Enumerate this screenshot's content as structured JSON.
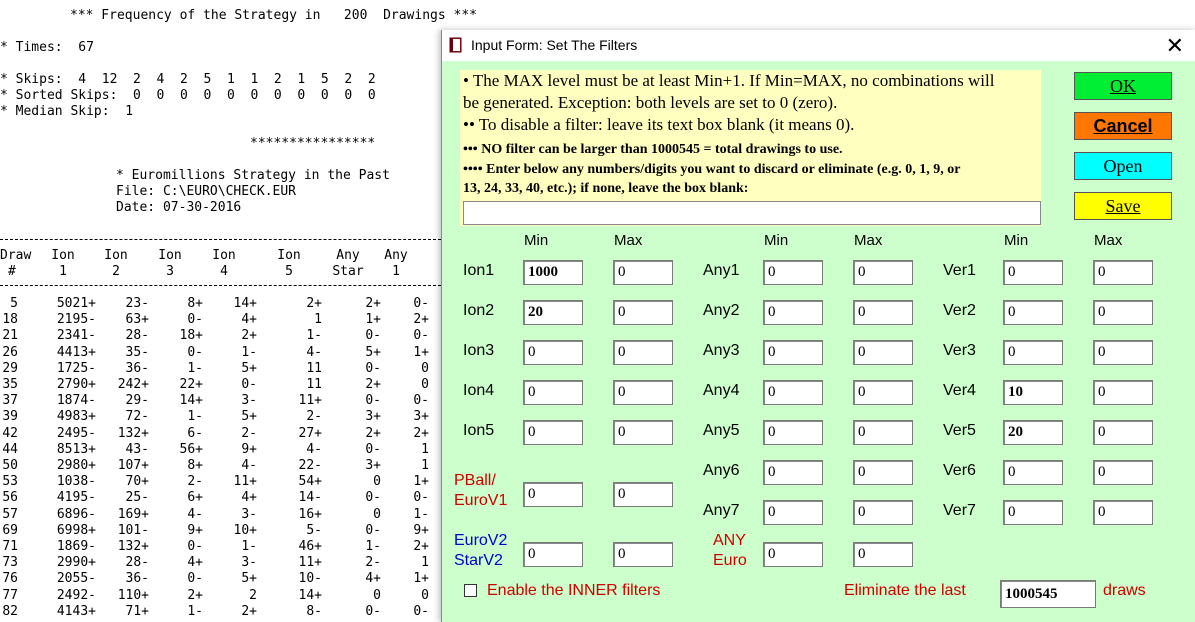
{
  "report": {
    "header": "*** Frequency of the Strategy in   200  Drawings ***",
    "times": "* Times:  67",
    "skips": "* Skips:  4  12  2  4  2  5  1  1  2  1  5  2  2",
    "sorted": "* Sorted Skips:  0  0  0  0  0  0  0  0  0  0  0",
    "median": "* Median Skip:  1",
    "stars": "****************",
    "strategy": "* Euromillions Strategy in the Past",
    "file": "File: C:\\EURO\\CHECK.EUR",
    "date": "Date: 07-30-2016",
    "columns": [
      {
        "h1": "Draw",
        "h2": "#"
      },
      {
        "h1": "Ion",
        "h2": "1"
      },
      {
        "h1": "Ion",
        "h2": "2"
      },
      {
        "h1": "Ion",
        "h2": "3"
      },
      {
        "h1": "Ion",
        "h2": "4"
      },
      {
        "h1": "Ion",
        "h2": "5"
      },
      {
        "h1": "Any",
        "h2": "Star"
      },
      {
        "h1": "Any",
        "h2": "1"
      }
    ],
    "rows": [
      [
        "5",
        "5021+",
        "23-",
        "8+",
        "14+",
        "2+",
        "2+",
        "0-"
      ],
      [
        "18",
        "2195-",
        "63+",
        "0-",
        "4+",
        "1",
        "1+",
        "2+"
      ],
      [
        "21",
        "2341-",
        "28-",
        "18+",
        "2+",
        "1-",
        "0-",
        "0-"
      ],
      [
        "26",
        "4413+",
        "35-",
        "0-",
        "1-",
        "4-",
        "5+",
        "1+"
      ],
      [
        "29",
        "1725-",
        "36-",
        "1-",
        "5+",
        "11",
        "0-",
        "0"
      ],
      [
        "35",
        "2790+",
        "242+",
        "22+",
        "0-",
        "11",
        "2+",
        "0"
      ],
      [
        "37",
        "1874-",
        "29-",
        "14+",
        "3-",
        "11+",
        "0-",
        "0-"
      ],
      [
        "39",
        "4983+",
        "72-",
        "1-",
        "5+",
        "2-",
        "3+",
        "3+"
      ],
      [
        "42",
        "2495-",
        "132+",
        "6-",
        "2-",
        "27+",
        "2+",
        "2+"
      ],
      [
        "44",
        "8513+",
        "43-",
        "56+",
        "9+",
        "4-",
        "0-",
        "1"
      ],
      [
        "50",
        "2980+",
        "107+",
        "8+",
        "4-",
        "22-",
        "3+",
        "1"
      ],
      [
        "53",
        "1038-",
        "70+",
        "2-",
        "11+",
        "54+",
        "0",
        "1+"
      ],
      [
        "56",
        "4195-",
        "25-",
        "6+",
        "4+",
        "14-",
        "0-",
        "0-"
      ],
      [
        "57",
        "6896-",
        "169+",
        "4-",
        "3-",
        "16+",
        "0",
        "1-"
      ],
      [
        "69",
        "6998+",
        "101-",
        "9+",
        "10+",
        "5-",
        "0-",
        "9+"
      ],
      [
        "71",
        "1869-",
        "132+",
        "0-",
        "1-",
        "46+",
        "1-",
        "2+"
      ],
      [
        "73",
        "2990+",
        "28-",
        "4+",
        "3-",
        "11+",
        "2-",
        "1"
      ],
      [
        "76",
        "2055-",
        "36-",
        "0-",
        "5+",
        "10-",
        "4+",
        "1+"
      ],
      [
        "77",
        "2492-",
        "110+",
        "2+",
        "2",
        "14+",
        "0",
        "0"
      ],
      [
        "82",
        "4143+",
        "71+",
        "1-",
        "2+",
        "8-",
        "0-",
        "0-"
      ]
    ]
  },
  "dialog": {
    "title": "Input Form: Set The Filters",
    "info": [
      "• The MAX level must be at least Min+1. If Min=MAX, no combinations will",
      "be generated.  Exception: both levels are set to 0 (zero).",
      "•• To disable a filter: leave its text box blank (it means 0).",
      "••• NO filter can be larger than 1000545 = total drawings to use.",
      "•••• Enter below any numbers/digits you want to discard or eliminate  (e.g.  0, 1, 9, or",
      "13, 24, 33, 40, etc.);  if none, leave the box blank:"
    ],
    "exclude_value": "",
    "buttons": {
      "ok": {
        "label": "OK",
        "color": "#00ee33"
      },
      "cancel": {
        "label": "Cancel",
        "color": "#ff7700"
      },
      "open": {
        "label": "Open",
        "color": "#00ffff"
      },
      "save": {
        "label": "Save",
        "color": "#ffff00"
      }
    },
    "min_label": "Min",
    "max_label": "Max",
    "col1": [
      {
        "label": "Ion1",
        "min": "1000",
        "max": "0"
      },
      {
        "label": "Ion2",
        "min": "20",
        "max": "0"
      },
      {
        "label": "Ion3",
        "min": "0",
        "max": "0"
      },
      {
        "label": "Ion4",
        "min": "0",
        "max": "0"
      },
      {
        "label": "Ion5",
        "min": "0",
        "max": "0"
      }
    ],
    "pball": {
      "label1": "PBall/",
      "label2": "EuroV1",
      "min": "0",
      "max": "0"
    },
    "eurov2": {
      "label1": "EuroV2",
      "label2": "StarV2",
      "min": "0",
      "max": "0"
    },
    "col2": [
      {
        "label": "Any1",
        "min": "0",
        "max": "0"
      },
      {
        "label": "Any2",
        "min": "0",
        "max": "0"
      },
      {
        "label": "Any3",
        "min": "0",
        "max": "0"
      },
      {
        "label": "Any4",
        "min": "0",
        "max": "0"
      },
      {
        "label": "Any5",
        "min": "0",
        "max": "0"
      },
      {
        "label": "Any6",
        "min": "0",
        "max": "0"
      },
      {
        "label": "Any7",
        "min": "0",
        "max": "0"
      }
    ],
    "anyeuro": {
      "label1": "ANY",
      "label2": "Euro",
      "min": "0",
      "max": "0"
    },
    "col3": [
      {
        "label": "Ver1",
        "min": "0",
        "max": "0"
      },
      {
        "label": "Ver2",
        "min": "0",
        "max": "0"
      },
      {
        "label": "Ver3",
        "min": "0",
        "max": "0"
      },
      {
        "label": "Ver4",
        "min": "10",
        "max": "0"
      },
      {
        "label": "Ver5",
        "min": "20",
        "max": "0"
      },
      {
        "label": "Ver6",
        "min": "0",
        "max": "0"
      },
      {
        "label": "Ver7",
        "min": "0",
        "max": "0"
      }
    ],
    "inner_label": "Enable the INNER filters",
    "inner_checked": false,
    "eliminate_label": "Eliminate the last",
    "eliminate_value": "1000545",
    "draws_label": "draws"
  }
}
